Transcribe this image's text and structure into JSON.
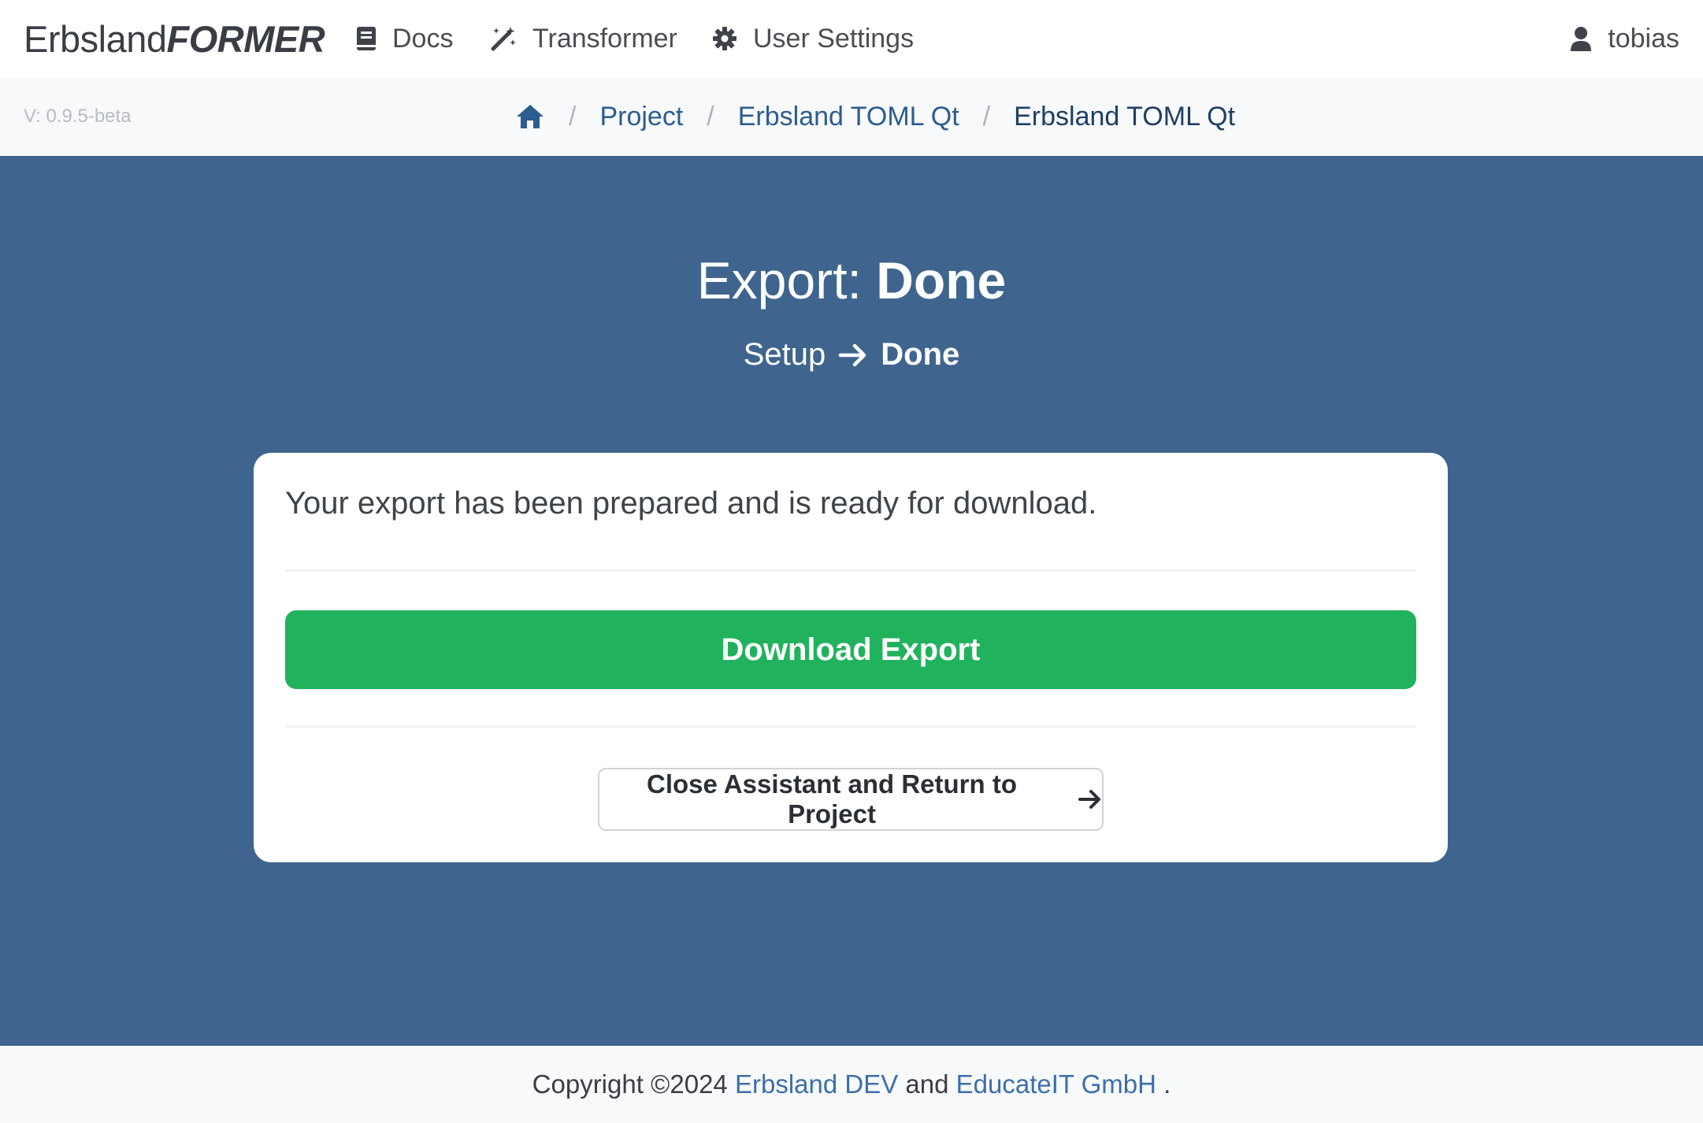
{
  "brand": {
    "light": "Erbsland",
    "strong": "FORMER"
  },
  "nav": {
    "docs": {
      "label": "Docs",
      "icon": "book-icon"
    },
    "transformer": {
      "label": "Transformer",
      "icon": "magic-wand-icon"
    },
    "settings": {
      "label": "User Settings",
      "icon": "gear-icon"
    },
    "user": {
      "label": "tobias",
      "icon": "user-icon"
    }
  },
  "version": "V: 0.9.5-beta",
  "breadcrumb": {
    "home_icon": "home-icon",
    "items": [
      "Project",
      "Erbsland TOML Qt",
      "Erbsland TOML Qt"
    ],
    "separator": "/"
  },
  "hero": {
    "title_prefix": "Export:",
    "title_status": "Done",
    "steps": [
      "Setup",
      "Done"
    ]
  },
  "card": {
    "message": "Your export has been prepared and is ready for download.",
    "download_label": "Download Export",
    "close_label": "Close Assistant and Return to Project"
  },
  "footer": {
    "prefix": "Copyright ©2024",
    "link1": "Erbsland DEV",
    "middle": "and",
    "link2": "EducateIT GmbH",
    "suffix": "."
  },
  "colors": {
    "hero_bg": "#3f658e",
    "download_green": "#21b25d",
    "link_blue": "#2d5d8f"
  }
}
